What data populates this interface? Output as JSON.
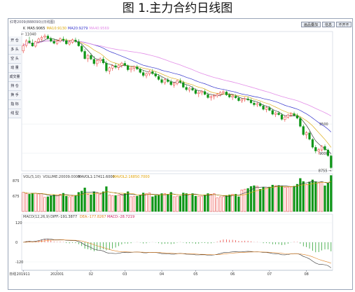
{
  "figure": {
    "title": "图 1.主力合约日线图"
  },
  "toolbar": {
    "header_text": "红枣2009(888090)(日线图)",
    "buttons": [
      "画品叠加",
      "信息",
      "不开不"
    ]
  },
  "sidebar": {
    "items": [
      "开 仓",
      "多 头",
      "空 头",
      "动 量",
      "成交量",
      "持 仓",
      "换 手",
      "指 标",
      "线 型"
    ]
  },
  "bottom_label": "日线",
  "colors": {
    "up": "#e8302a",
    "down": "#109618",
    "ma5": "#222222",
    "ma10": "#d9a400",
    "ma20": "#3333cc",
    "ma40": "#e38ee8",
    "vol_ma1": "#333333",
    "vol_ma2": "#e0a000",
    "dif": "#333333",
    "dea": "#e08020"
  },
  "chart_data": [
    {
      "type": "candlestick",
      "panel": "price",
      "legend": [
        {
          "text": "K",
          "color": "#222222"
        },
        {
          "text": "MA5:9065",
          "color": "#222222"
        },
        {
          "text": "MA10:9130",
          "color": "#d9a400"
        },
        {
          "text": "MA20:9279",
          "color": "#3333cc"
        },
        {
          "text": "MA40:9569",
          "color": "#e38ee8"
        }
      ],
      "y_tick_labels": [
        9500,
        9000
      ],
      "annotations": {
        "high_label": "11040",
        "low_label": "8755"
      },
      "ohlc": [
        [
          10748,
          10880,
          10710,
          10840
        ],
        [
          10842,
          10950,
          10810,
          10920
        ],
        [
          10918,
          10990,
          10870,
          10890
        ],
        [
          10885,
          10945,
          10820,
          10832
        ],
        [
          10830,
          10920,
          10805,
          10905
        ],
        [
          10902,
          10975,
          10880,
          10950
        ],
        [
          10948,
          11010,
          10920,
          10981
        ],
        [
          10985,
          11040,
          10950,
          11005
        ],
        [
          11002,
          11030,
          10940,
          10965
        ],
        [
          10960,
          10990,
          10895,
          10915
        ],
        [
          10910,
          10960,
          10860,
          10880
        ],
        [
          10875,
          10940,
          10850,
          10920
        ],
        [
          10918,
          10980,
          10890,
          10955
        ],
        [
          10950,
          10995,
          10900,
          10930
        ],
        [
          10925,
          10960,
          10850,
          10870
        ],
        [
          10865,
          10930,
          10840,
          10900
        ],
        [
          10895,
          10960,
          10870,
          10938
        ],
        [
          10935,
          10975,
          10885,
          10910
        ],
        [
          10905,
          10950,
          10820,
          10835
        ],
        [
          10830,
          10860,
          10720,
          10742
        ],
        [
          10740,
          10780,
          10600,
          10618
        ],
        [
          10615,
          10700,
          10560,
          10672
        ],
        [
          10670,
          10710,
          10590,
          10610
        ],
        [
          10605,
          10660,
          10500,
          10532
        ],
        [
          10530,
          10610,
          10480,
          10585
        ],
        [
          10580,
          10640,
          10540,
          10612
        ],
        [
          10608,
          10650,
          10520,
          10545
        ],
        [
          10540,
          10580,
          10380,
          10410
        ],
        [
          10405,
          10480,
          10350,
          10460
        ],
        [
          10455,
          10520,
          10410,
          10498
        ],
        [
          10495,
          10540,
          10440,
          10470
        ],
        [
          10465,
          10520,
          10420,
          10505
        ],
        [
          10500,
          10560,
          10460,
          10540
        ],
        [
          10536,
          10580,
          10480,
          10502
        ],
        [
          10498,
          10520,
          10400,
          10428
        ],
        [
          10425,
          10480,
          10380,
          10455
        ],
        [
          10450,
          10500,
          10400,
          10480
        ],
        [
          10476,
          10510,
          10420,
          10440
        ],
        [
          10436,
          10460,
          10360,
          10382
        ],
        [
          10378,
          10420,
          10300,
          10330
        ],
        [
          10326,
          10380,
          10280,
          10360
        ],
        [
          10356,
          10420,
          10320,
          10398
        ],
        [
          10395,
          10440,
          10340,
          10362
        ],
        [
          10358,
          10400,
          10290,
          10318
        ],
        [
          10314,
          10350,
          10240,
          10262
        ],
        [
          10258,
          10300,
          10180,
          10210
        ],
        [
          10206,
          10280,
          10170,
          10258
        ],
        [
          10254,
          10290,
          10200,
          10225
        ],
        [
          10220,
          10260,
          10150,
          10172
        ],
        [
          10168,
          10220,
          10120,
          10195
        ],
        [
          10190,
          10260,
          10160,
          10238
        ],
        [
          10234,
          10280,
          10190,
          10212
        ],
        [
          10208,
          10240,
          10110,
          10130
        ],
        [
          10126,
          10170,
          10060,
          10088
        ],
        [
          10084,
          10130,
          10040,
          10112
        ],
        [
          10108,
          10150,
          10060,
          10080
        ],
        [
          10076,
          10110,
          10000,
          10022
        ],
        [
          10018,
          10060,
          9960,
          10040
        ],
        [
          10036,
          10080,
          9990,
          10058
        ],
        [
          10054,
          10090,
          9990,
          10006
        ],
        [
          10002,
          10040,
          9930,
          9952
        ],
        [
          9948,
          9990,
          9900,
          9972
        ],
        [
          9968,
          10010,
          9920,
          9985
        ],
        [
          9981,
          10030,
          9950,
          10008
        ],
        [
          10004,
          10060,
          9970,
          10040
        ],
        [
          10036,
          10080,
          10000,
          10052
        ],
        [
          10048,
          10070,
          9980,
          9998
        ],
        [
          9994,
          10030,
          9940,
          9962
        ],
        [
          9958,
          10000,
          9910,
          9978
        ],
        [
          9974,
          10010,
          9930,
          9948
        ],
        [
          9944,
          9980,
          9880,
          9900
        ],
        [
          9896,
          9940,
          9860,
          9920
        ],
        [
          9916,
          9960,
          9880,
          9935
        ],
        [
          9931,
          9970,
          9890,
          9912
        ],
        [
          9908,
          9940,
          9840,
          9862
        ],
        [
          9858,
          9900,
          9800,
          9830
        ],
        [
          9826,
          9870,
          9790,
          9850
        ],
        [
          9846,
          9880,
          9790,
          9812
        ],
        [
          9808,
          9840,
          9730,
          9752
        ],
        [
          9748,
          9800,
          9700,
          9782
        ],
        [
          9778,
          9810,
          9720,
          9735
        ],
        [
          9731,
          9760,
          9650,
          9668
        ],
        [
          9664,
          9710,
          9620,
          9690
        ],
        [
          9686,
          9720,
          9640,
          9660
        ],
        [
          9656,
          9690,
          9560,
          9582
        ],
        [
          9578,
          9640,
          9540,
          9620
        ],
        [
          9616,
          9680,
          9590,
          9655
        ],
        [
          9651,
          9700,
          9620,
          9680
        ],
        [
          9676,
          9710,
          9630,
          9648
        ],
        [
          9644,
          9680,
          9580,
          9600
        ],
        [
          9596,
          9620,
          9440,
          9462
        ],
        [
          9458,
          9490,
          9300,
          9320
        ],
        [
          9316,
          9380,
          9250,
          9352
        ],
        [
          9348,
          9380,
          9220,
          9240
        ],
        [
          9236,
          9260,
          9080,
          9105
        ],
        [
          9101,
          9140,
          9000,
          9040
        ],
        [
          9036,
          9090,
          8980,
          9062
        ],
        [
          9058,
          9140,
          9030,
          9120
        ],
        [
          9116,
          9150,
          9040,
          9060
        ],
        [
          9056,
          9080,
          8940,
          8960
        ],
        [
          8956,
          8980,
          8730,
          8755
        ]
      ]
    },
    {
      "type": "bar",
      "panel": "volume",
      "legend": [
        {
          "text": "VOL(5,10)",
          "color": "#444444"
        },
        {
          "text": "VOLUME:20009.0000",
          "color": "#444444"
        },
        {
          "text": "MAVOL1:17411.6000",
          "color": "#333333"
        },
        {
          "text": "MAVOL2:16850.7000",
          "color": "#e0a000"
        }
      ],
      "y_tick_labels": [
        875,
        675
      ]
    },
    {
      "type": "bar",
      "panel": "macd",
      "legend": [
        {
          "text": "MACD(12,26,9)",
          "color": "#444444"
        },
        {
          "text": "DIFF:-191.3877",
          "color": "#333333"
        },
        {
          "text": "DEA:-177.8267",
          "color": "#e08020"
        },
        {
          "text": "MACD:-28.7219",
          "color": "#cc2266"
        }
      ],
      "y_tick_labels": [
        120,
        0,
        -120
      ]
    }
  ],
  "x_axis": {
    "tick_labels": [
      "201911",
      "202001",
      "02",
      "03",
      "04",
      "05",
      "06",
      "07",
      "08"
    ]
  }
}
